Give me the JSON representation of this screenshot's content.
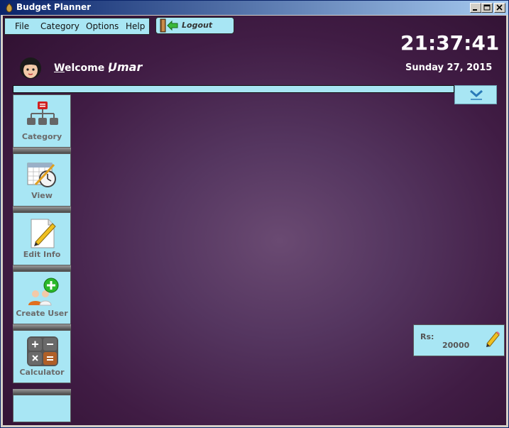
{
  "window": {
    "title": "Budget Planner",
    "controls": [
      "minimize",
      "maximize",
      "close"
    ]
  },
  "menu": {
    "items": [
      "File",
      "Category",
      "Options",
      "Help"
    ]
  },
  "logout": {
    "label": "Logout"
  },
  "header": {
    "welcome_first": "W",
    "welcome_rest": "elcome ,",
    "username": "Umar",
    "time": "21:37:41",
    "date": "Sunday 27, 2015"
  },
  "sidebar": {
    "items": [
      {
        "label": "Category",
        "icon": "category-icon"
      },
      {
        "label": "View",
        "icon": "calendar-clock-icon"
      },
      {
        "label": "Edit Info",
        "icon": "edit-document-icon"
      },
      {
        "label": "Create User",
        "icon": "add-user-icon"
      },
      {
        "label": "Calculator",
        "icon": "calculator-icon"
      }
    ]
  },
  "budget": {
    "label": "Rs:",
    "value": "20000"
  },
  "colors": {
    "panel": "#a8e6f4",
    "background": "#4a2650",
    "title_bar": "#0a246a"
  }
}
